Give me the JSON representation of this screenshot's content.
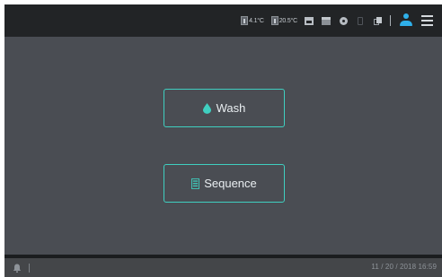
{
  "status_bar": {
    "temp_1": "4.1°C",
    "temp_2": "20.5°C",
    "icons": [
      "thermometer-icon",
      "thermometer-icon",
      "printer-icon",
      "plate-stacker-icon",
      "disc-icon",
      "usb-icon",
      "copy-icon",
      "user-icon",
      "menu-icon"
    ]
  },
  "main": {
    "wash_label": "Wash",
    "sequence_label": "Sequence"
  },
  "bottom_bar": {
    "datetime": "11 / 20 / 2018 16:59"
  },
  "colors": {
    "background": "#4a4d53",
    "topbar": "#222426",
    "accent": "#3fcfc0",
    "user": "#2fb0ea"
  }
}
